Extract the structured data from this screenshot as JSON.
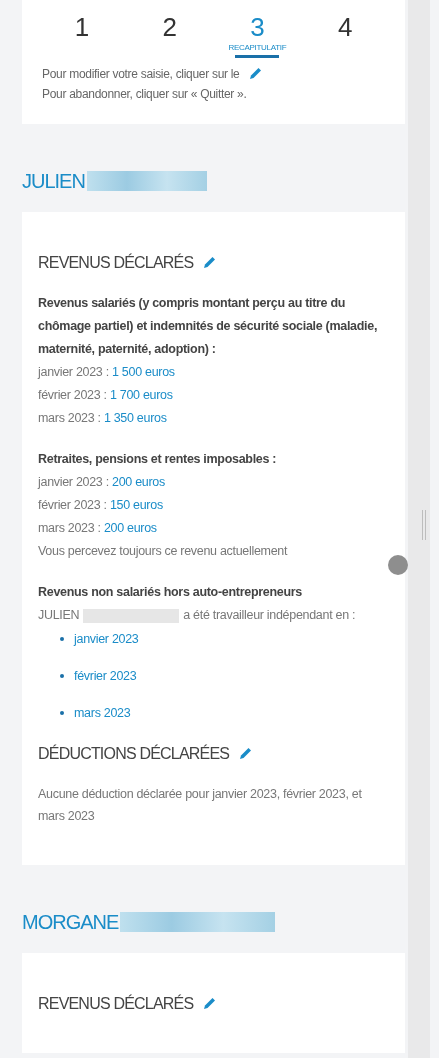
{
  "steps": [
    {
      "number": "1",
      "selected": false
    },
    {
      "number": "2",
      "selected": false
    },
    {
      "number": "3",
      "selected": true,
      "caption": "RECAPITULATIF"
    },
    {
      "number": "4",
      "selected": false
    }
  ],
  "instructions": [
    "Pour modifier votre saisie, cliquer sur le",
    "Pour abandonner, cliquer sur « Quitter »."
  ],
  "persons": [
    {
      "first_name": "JULIEN",
      "sections": [
        {
          "title": "REVENUS DÉCLARÉS",
          "blocks": [
            {
              "kind": "amounts",
              "heading": "Revenus salariés (y compris montant perçu au titre du chômage partiel) et indemnités de sécurité sociale (maladie, maternité, paternité, adoption) :",
              "rows": [
                {
                  "label": "janvier 2023 :",
                  "amount": "1 500 euros"
                },
                {
                  "label": "février 2023 :",
                  "amount": "1 700 euros"
                },
                {
                  "label": "mars 2023 :",
                  "amount": "1 350 euros"
                }
              ]
            },
            {
              "kind": "amounts",
              "heading": "Retraites, pensions et rentes imposables :",
              "rows": [
                {
                  "label": "janvier 2023 :",
                  "amount": "200 euros"
                },
                {
                  "label": "février 2023 :",
                  "amount": "150 euros"
                },
                {
                  "label": "mars 2023 :",
                  "amount": "200 euros"
                }
              ],
              "note": "Vous percevez toujours ce revenu actuellement"
            },
            {
              "kind": "months",
              "heading": "Revenus non salariés hors auto-entrepreneurs",
              "lead_name": "JULIEN",
              "lead_text": "a été travailleur indépendant en :",
              "items": [
                "janvier 2023",
                "février 2023",
                "mars 2023"
              ]
            }
          ]
        },
        {
          "title": "DÉDUCTIONS DÉCLARÉES",
          "blocks": [
            {
              "kind": "text",
              "text": "Aucune déduction déclarée pour janvier 2023, février 2023, et mars 2023"
            }
          ]
        }
      ]
    },
    {
      "first_name": "MORGANE",
      "sections": [
        {
          "title": "REVENUS DÉCLARÉS"
        }
      ]
    }
  ]
}
